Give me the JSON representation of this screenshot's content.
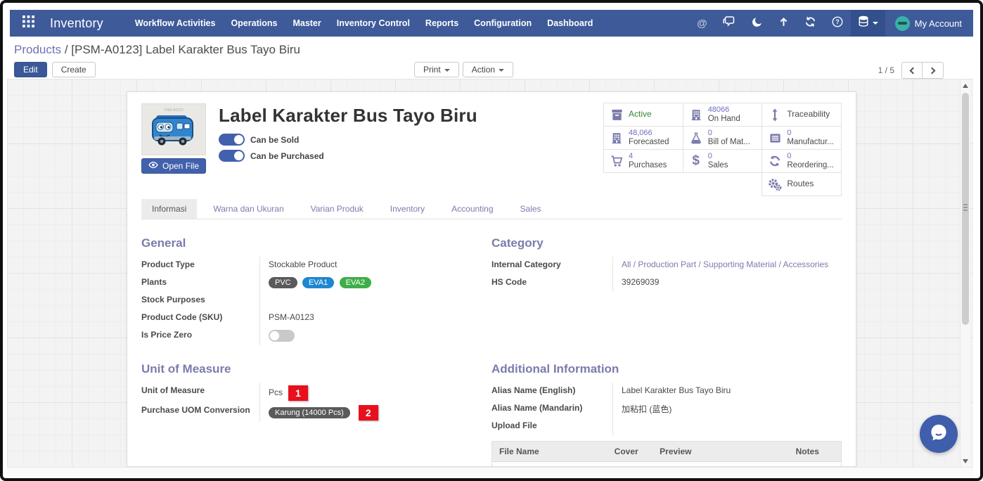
{
  "colors": {
    "topbar": "#3e5a99",
    "accent_purple": "#7b7bad",
    "link": "#7070b8",
    "primary_button": "#3a5998",
    "toggle_on": "#4261ac",
    "active_green": "#368436",
    "badge_red": "#e8101c",
    "stat_value": "#6f6fc0",
    "tag_dark": "#5a5a5a",
    "tag_blue": "#1e87d0",
    "tag_green": "#3fae49",
    "chat_bubble_bg": "#3f5fad"
  },
  "navbar": {
    "brand": "Inventory",
    "menu": [
      "Workflow Activities",
      "Operations",
      "Master",
      "Inventory Control",
      "Reports",
      "Configuration",
      "Dashboard"
    ],
    "at_symbol": "@",
    "user_label": "My Account"
  },
  "breadcrumb": {
    "parent": "Products",
    "separator": " / ",
    "current": "[PSM-A0123] Label Karakter Bus Tayo Biru"
  },
  "toolbar": {
    "edit": "Edit",
    "create": "Create",
    "print": "Print",
    "action": "Action",
    "pager": "1 / 5"
  },
  "product": {
    "title": "Label Karakter Bus Tayo Biru",
    "image_caption": "PSM-A0123",
    "open_file": "Open File",
    "toggle_sold": "Can be Sold",
    "toggle_purchased": "Can be Purchased"
  },
  "stats": {
    "active": {
      "label": "Active"
    },
    "on_hand": {
      "value": "48066",
      "label": "On Hand"
    },
    "traceability": {
      "label": "Traceability"
    },
    "forecasted": {
      "value": "48,066",
      "label": "Forecasted"
    },
    "bom": {
      "value": "0",
      "label": "Bill of Mat..."
    },
    "manufacturing": {
      "value": "0",
      "label": "Manufactur..."
    },
    "purchases": {
      "value": "4",
      "label": "Purchases"
    },
    "sales": {
      "value": "0",
      "label": "Sales"
    },
    "reordering": {
      "value": "0",
      "label": "Reordering..."
    },
    "routes": {
      "label": "Routes"
    }
  },
  "tabs": [
    {
      "label": "Informasi"
    },
    {
      "label": "Warna dan Ukuran"
    },
    {
      "label": "Varian Produk"
    },
    {
      "label": "Inventory"
    },
    {
      "label": "Accounting"
    },
    {
      "label": "Sales"
    }
  ],
  "general": {
    "title": "General",
    "product_type_label": "Product Type",
    "product_type": "Stockable Product",
    "plants_label": "Plants",
    "plants": [
      {
        "text": "PVC"
      },
      {
        "text": "EVA1"
      },
      {
        "text": "EVA2"
      }
    ],
    "stock_purposes_label": "Stock Purposes",
    "stock_purposes": "",
    "sku_label": "Product Code (SKU)",
    "sku": "PSM-A0123",
    "price_zero_label": "Is Price Zero"
  },
  "category": {
    "title": "Category",
    "internal_label": "Internal Category",
    "internal": "All / Production Part / Supporting Material / Accessories",
    "hs_label": "HS Code",
    "hs": "39269039"
  },
  "uom": {
    "title": "Unit of Measure",
    "uom_label": "Unit of Measure",
    "uom": "Pcs",
    "badge1": "1",
    "conversion_label": "Purchase UOM Conversion",
    "conversion": "Karung (14000 Pcs)",
    "badge2": "2"
  },
  "additional": {
    "title": "Additional Information",
    "alias_en_label": "Alias Name (English)",
    "alias_en": "Label Karakter Bus Tayo Biru",
    "alias_zh_label": "Alias Name (Mandarin)",
    "alias_zh": "加粘扣 (蓝色)",
    "upload_label": "Upload File",
    "table_headers": [
      "File Name",
      "Cover",
      "Preview",
      "Notes"
    ]
  }
}
